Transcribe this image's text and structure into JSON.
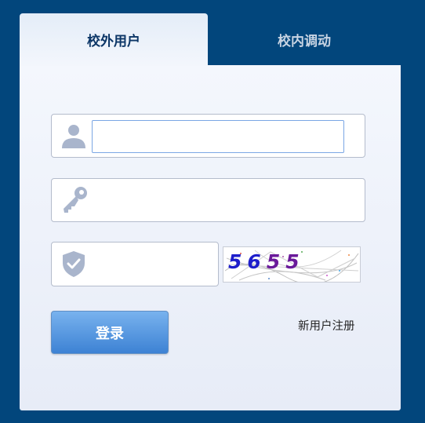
{
  "tabs": {
    "external_user": "校外用户",
    "internal_transfer": "校内调动"
  },
  "form": {
    "username_value": "",
    "password_value": "",
    "captcha_value": "",
    "captcha_text": "5655",
    "login_label": "登录",
    "register_label": "新用户注册"
  },
  "icons": {
    "username": "user-icon",
    "password": "key-icon",
    "captcha": "shield-check-icon"
  },
  "colors": {
    "background": "#02467c",
    "active_tab_text": "#0c3667",
    "inactive_tab_text": "#c8d4e3",
    "button": "#4a8fde",
    "icon": "#a9b5cc",
    "captcha_digits": [
      "#1e1ecb",
      "#1e1ecb",
      "#6a1a9a",
      "#6a1a9a"
    ]
  }
}
